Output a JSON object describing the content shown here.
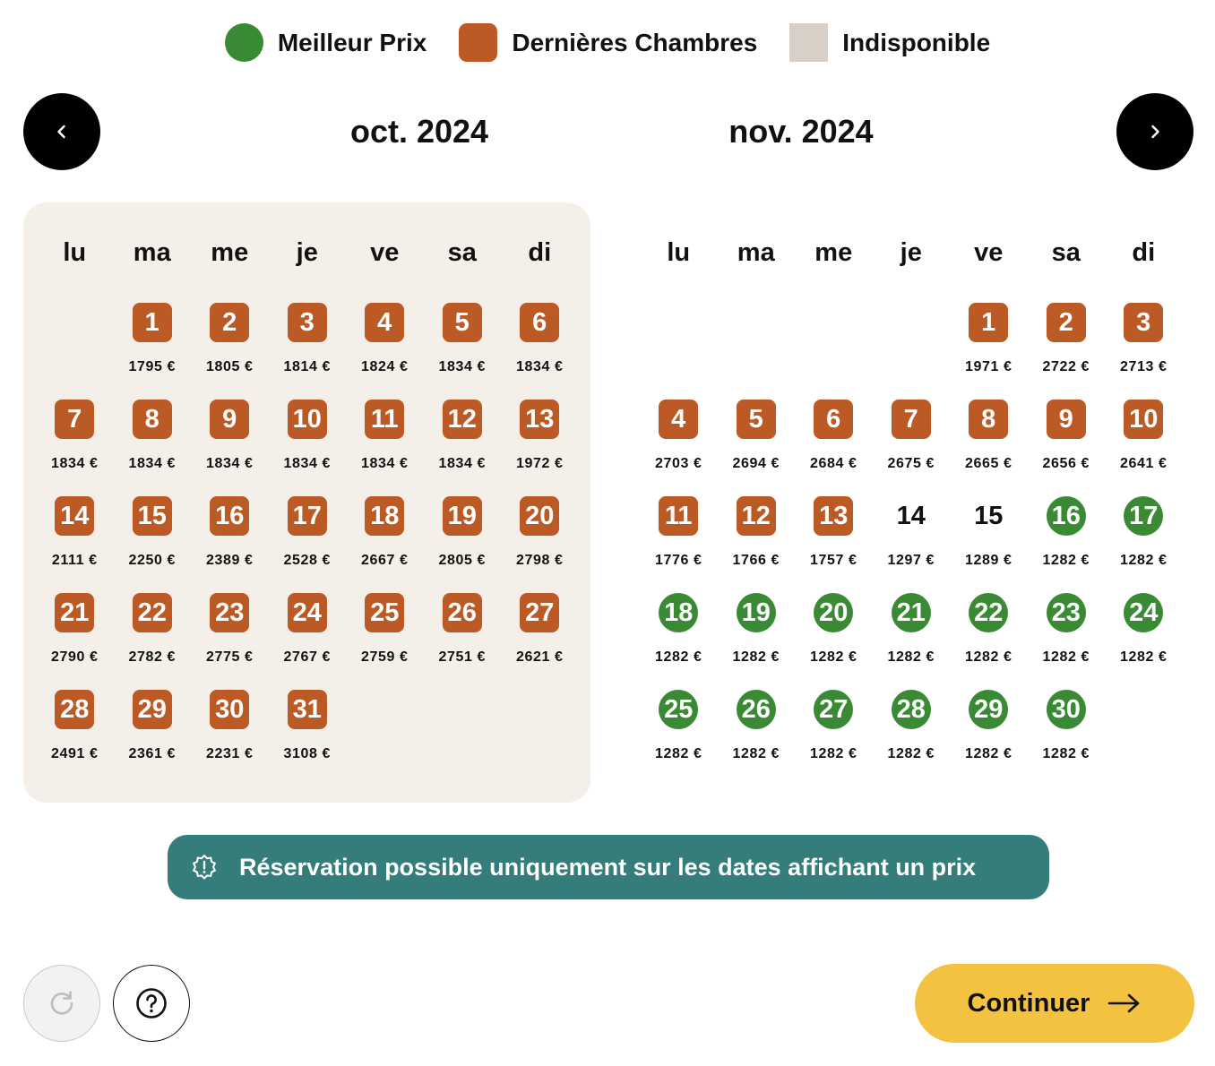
{
  "legend": {
    "best_price": "Meilleur Prix",
    "last_rooms": "Dernières Chambres",
    "unavailable": "Indisponible",
    "colors": {
      "best": "#3a8a35",
      "last": "#bb5a24",
      "unavailable": "#d8cfc6"
    }
  },
  "nav": {
    "prev_icon": "chevron-left-icon",
    "next_icon": "chevron-right-icon"
  },
  "weekdays": [
    "lu",
    "ma",
    "me",
    "je",
    "ve",
    "sa",
    "di"
  ],
  "months": [
    {
      "title": "oct. 2024",
      "offset": 1,
      "days": [
        {
          "d": "1",
          "p": "1795 €",
          "s": "last"
        },
        {
          "d": "2",
          "p": "1805 €",
          "s": "last"
        },
        {
          "d": "3",
          "p": "1814 €",
          "s": "last"
        },
        {
          "d": "4",
          "p": "1824 €",
          "s": "last"
        },
        {
          "d": "5",
          "p": "1834 €",
          "s": "last"
        },
        {
          "d": "6",
          "p": "1834 €",
          "s": "last"
        },
        {
          "d": "7",
          "p": "1834 €",
          "s": "last"
        },
        {
          "d": "8",
          "p": "1834 €",
          "s": "last"
        },
        {
          "d": "9",
          "p": "1834 €",
          "s": "last"
        },
        {
          "d": "10",
          "p": "1834 €",
          "s": "last"
        },
        {
          "d": "11",
          "p": "1834 €",
          "s": "last"
        },
        {
          "d": "12",
          "p": "1834 €",
          "s": "last"
        },
        {
          "d": "13",
          "p": "1972 €",
          "s": "last"
        },
        {
          "d": "14",
          "p": "2111 €",
          "s": "last"
        },
        {
          "d": "15",
          "p": "2250 €",
          "s": "last"
        },
        {
          "d": "16",
          "p": "2389 €",
          "s": "last"
        },
        {
          "d": "17",
          "p": "2528 €",
          "s": "last"
        },
        {
          "d": "18",
          "p": "2667 €",
          "s": "last"
        },
        {
          "d": "19",
          "p": "2805 €",
          "s": "last"
        },
        {
          "d": "20",
          "p": "2798 €",
          "s": "last"
        },
        {
          "d": "21",
          "p": "2790 €",
          "s": "last"
        },
        {
          "d": "22",
          "p": "2782 €",
          "s": "last"
        },
        {
          "d": "23",
          "p": "2775 €",
          "s": "last"
        },
        {
          "d": "24",
          "p": "2767 €",
          "s": "last"
        },
        {
          "d": "25",
          "p": "2759 €",
          "s": "last"
        },
        {
          "d": "26",
          "p": "2751 €",
          "s": "last"
        },
        {
          "d": "27",
          "p": "2621 €",
          "s": "last"
        },
        {
          "d": "28",
          "p": "2491 €",
          "s": "last"
        },
        {
          "d": "29",
          "p": "2361 €",
          "s": "last"
        },
        {
          "d": "30",
          "p": "2231 €",
          "s": "last"
        },
        {
          "d": "31",
          "p": "3108 €",
          "s": "last"
        }
      ]
    },
    {
      "title": "nov. 2024",
      "offset": 4,
      "days": [
        {
          "d": "1",
          "p": "1971 €",
          "s": "last"
        },
        {
          "d": "2",
          "p": "2722 €",
          "s": "last"
        },
        {
          "d": "3",
          "p": "2713 €",
          "s": "last"
        },
        {
          "d": "4",
          "p": "2703 €",
          "s": "last"
        },
        {
          "d": "5",
          "p": "2694 €",
          "s": "last"
        },
        {
          "d": "6",
          "p": "2684 €",
          "s": "last"
        },
        {
          "d": "7",
          "p": "2675 €",
          "s": "last"
        },
        {
          "d": "8",
          "p": "2665 €",
          "s": "last"
        },
        {
          "d": "9",
          "p": "2656 €",
          "s": "last"
        },
        {
          "d": "10",
          "p": "2641 €",
          "s": "last"
        },
        {
          "d": "11",
          "p": "1776 €",
          "s": "last"
        },
        {
          "d": "12",
          "p": "1766 €",
          "s": "last"
        },
        {
          "d": "13",
          "p": "1757 €",
          "s": "last"
        },
        {
          "d": "14",
          "p": "1297 €",
          "s": "plain"
        },
        {
          "d": "15",
          "p": "1289 €",
          "s": "plain"
        },
        {
          "d": "16",
          "p": "1282 €",
          "s": "best"
        },
        {
          "d": "17",
          "p": "1282 €",
          "s": "best"
        },
        {
          "d": "18",
          "p": "1282 €",
          "s": "best"
        },
        {
          "d": "19",
          "p": "1282 €",
          "s": "best"
        },
        {
          "d": "20",
          "p": "1282 €",
          "s": "best"
        },
        {
          "d": "21",
          "p": "1282 €",
          "s": "best"
        },
        {
          "d": "22",
          "p": "1282 €",
          "s": "best"
        },
        {
          "d": "23",
          "p": "1282 €",
          "s": "best"
        },
        {
          "d": "24",
          "p": "1282 €",
          "s": "best"
        },
        {
          "d": "25",
          "p": "1282 €",
          "s": "best"
        },
        {
          "d": "26",
          "p": "1282 €",
          "s": "best"
        },
        {
          "d": "27",
          "p": "1282 €",
          "s": "best"
        },
        {
          "d": "28",
          "p": "1282 €",
          "s": "best"
        },
        {
          "d": "29",
          "p": "1282 €",
          "s": "best"
        },
        {
          "d": "30",
          "p": "1282 €",
          "s": "best"
        }
      ]
    }
  ],
  "notice": {
    "text": "Réservation possible uniquement sur les dates affichant un prix",
    "icon": "alert-badge-icon"
  },
  "footer": {
    "refresh_icon": "refresh-icon",
    "help_icon": "help-icon",
    "continue_label": "Continuer",
    "continue_icon": "arrow-right-icon",
    "continue_color": "#f4c241"
  }
}
